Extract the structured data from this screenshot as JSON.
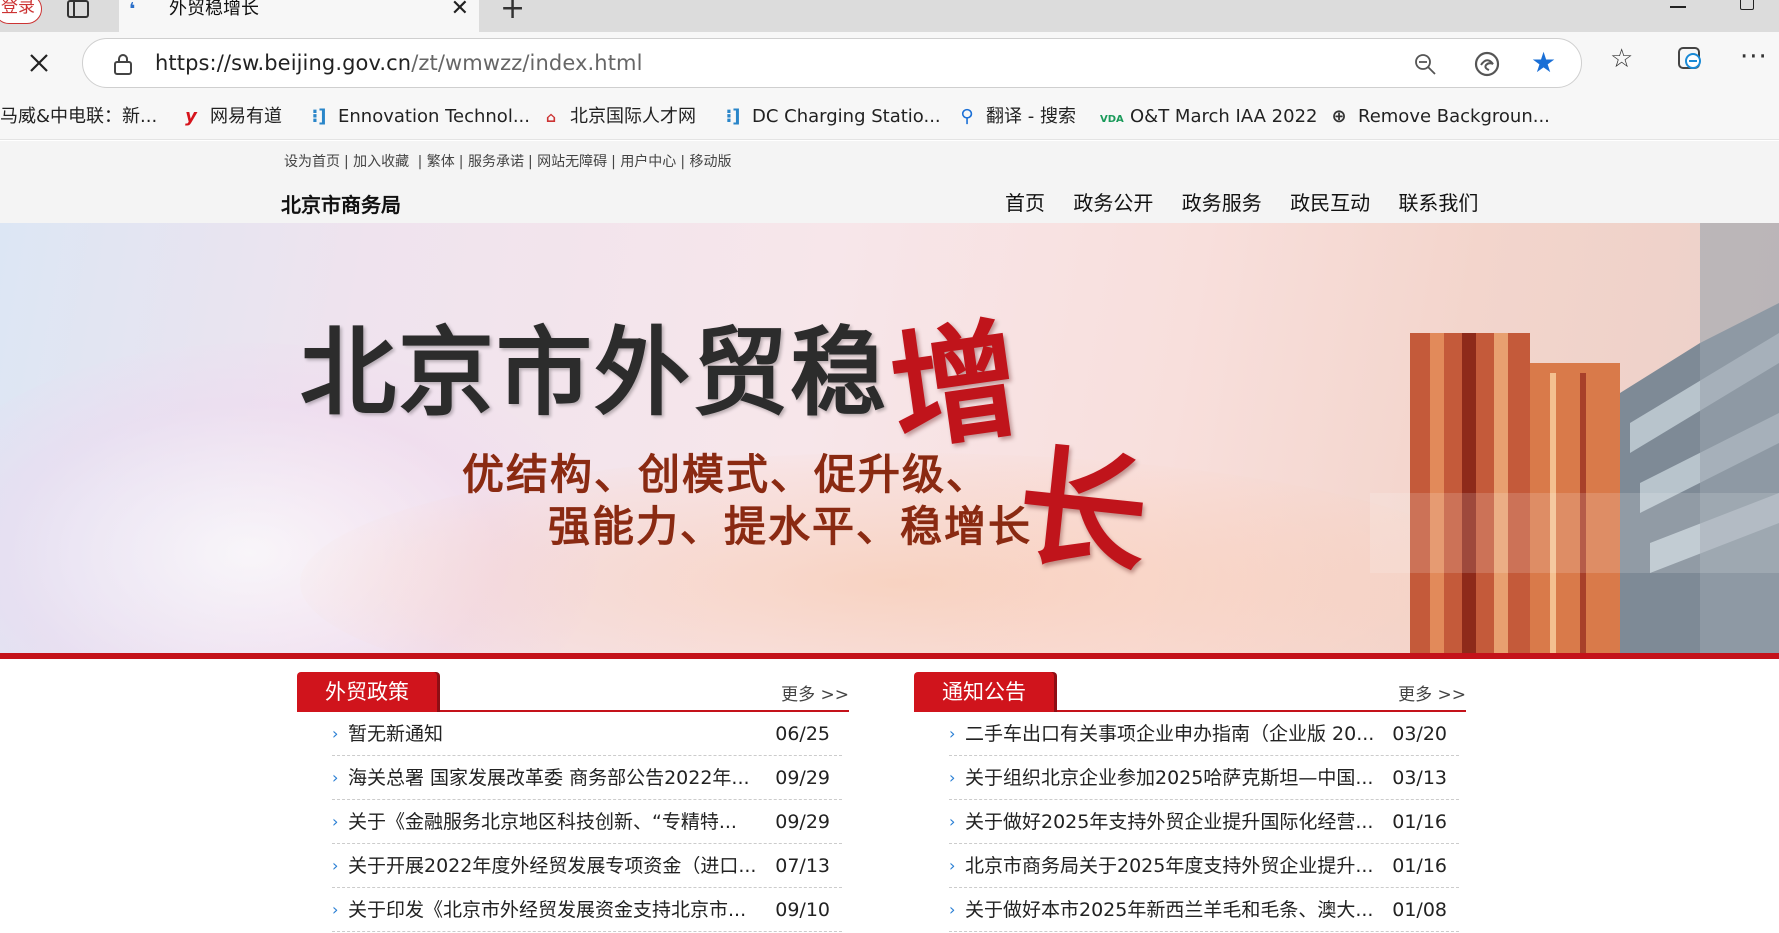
{
  "browser": {
    "login_label": "登录",
    "tab_title": "外贸稳增长",
    "url_host": "https://sw.beijing.gov.cn",
    "url_path": "/zt/wmwzz/index.html",
    "bookmarks": [
      {
        "label": "马威&中电联：新...",
        "icon": ""
      },
      {
        "label": "网易有道",
        "icon": "y"
      },
      {
        "label": "Ennovation Technol...",
        "icon": "ennovation-icon"
      },
      {
        "label": "北京国际人才网",
        "icon": "talent-icon"
      },
      {
        "label": "DC Charging Statio...",
        "icon": "dc-icon"
      },
      {
        "label": "翻译 - 搜索",
        "icon": "search-icon"
      },
      {
        "label": "O&T March IAA 2022",
        "icon": "vda-icon"
      },
      {
        "label": "Remove Backgroun...",
        "icon": "globe-icon"
      }
    ],
    "vda_text": "VDA"
  },
  "site": {
    "utility_links": [
      "设为首页",
      "加入收藏",
      "繁体",
      "服务承诺",
      "网站无障碍",
      "用户中心",
      "移动版"
    ],
    "name": "北京市商务局",
    "nav": [
      "首页",
      "政务公开",
      "政务服务",
      "政民互动",
      "联系我们"
    ]
  },
  "banner": {
    "title": "北京市外贸稳",
    "title_zeng": "增",
    "title_zhang": "长",
    "sub1": "优结构、创模式、促升级、",
    "sub2": "强能力、提水平、稳增长"
  },
  "columns": {
    "policy": {
      "heading": "外贸政策",
      "more": "更多 >>",
      "items": [
        {
          "title": "暂无新通知",
          "date": "06/25"
        },
        {
          "title": "海关总署 国家发展改革委 商务部公告2022年...",
          "date": "09/29"
        },
        {
          "title": "关于《金融服务北京地区科技创新、“专精特...",
          "date": "09/29"
        },
        {
          "title": "关于开展2022年度外经贸发展专项资金（进口...",
          "date": "07/13"
        },
        {
          "title": "关于印发《北京市外经贸发展资金支持北京市...",
          "date": "09/10"
        }
      ]
    },
    "notice": {
      "heading": "通知公告",
      "more": "更多 >>",
      "items": [
        {
          "title": "二手车出口有关事项企业申办指南（企业版 20...",
          "date": "03/20"
        },
        {
          "title": "关于组织北京企业参加2025哈萨克斯坦—中国...",
          "date": "03/13"
        },
        {
          "title": "关于做好2025年支持外贸企业提升国际化经营...",
          "date": "01/16"
        },
        {
          "title": "北京市商务局关于2025年度支持外贸企业提升...",
          "date": "01/16"
        },
        {
          "title": "关于做好本市2025年新西兰羊毛和毛条、澳大...",
          "date": "01/08"
        }
      ]
    }
  },
  "colors": {
    "brand_red": "#c4121a",
    "link_arrow": "#2a7fd4",
    "edge_blue": "#1a6fd6"
  }
}
